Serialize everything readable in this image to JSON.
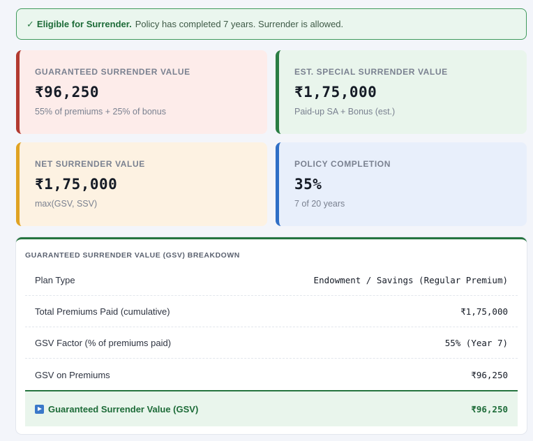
{
  "banner": {
    "check": "✓",
    "title": "Eligible for Surrender.",
    "message": "Policy has completed 7 years. Surrender is allowed."
  },
  "cards": [
    {
      "label": "GUARANTEED SURRENDER VALUE",
      "value": "₹96,250",
      "sub": "55% of premiums + 25% of bonus",
      "accent": "#b23a30"
    },
    {
      "label": "EST. SPECIAL SURRENDER VALUE",
      "value": "₹1,75,000",
      "sub": "Paid-up SA + Bonus (est.)",
      "accent": "#2a7d43"
    },
    {
      "label": "NET SURRENDER VALUE",
      "value": "₹1,75,000",
      "sub": "max(GSV, SSV)",
      "accent": "#e0a323"
    },
    {
      "label": "POLICY COMPLETION",
      "value": "35%",
      "sub": "7 of 20 years",
      "accent": "#2f6fc6"
    }
  ],
  "breakdown": {
    "heading": "GUARANTEED SURRENDER VALUE (GSV) BREAKDOWN",
    "rows": [
      {
        "label": "Plan Type",
        "value": "Endowment / Savings (Regular Premium)"
      },
      {
        "label": "Total Premiums Paid (cumulative)",
        "value": "₹1,75,000"
      },
      {
        "label": "GSV Factor (% of premiums paid)",
        "value": "55% (Year 7)"
      },
      {
        "label": "GSV on Premiums",
        "value": "₹96,250"
      }
    ],
    "total": {
      "icon": "play-icon",
      "label": "Guaranteed Surrender Value (GSV)",
      "value": "₹96,250"
    }
  }
}
